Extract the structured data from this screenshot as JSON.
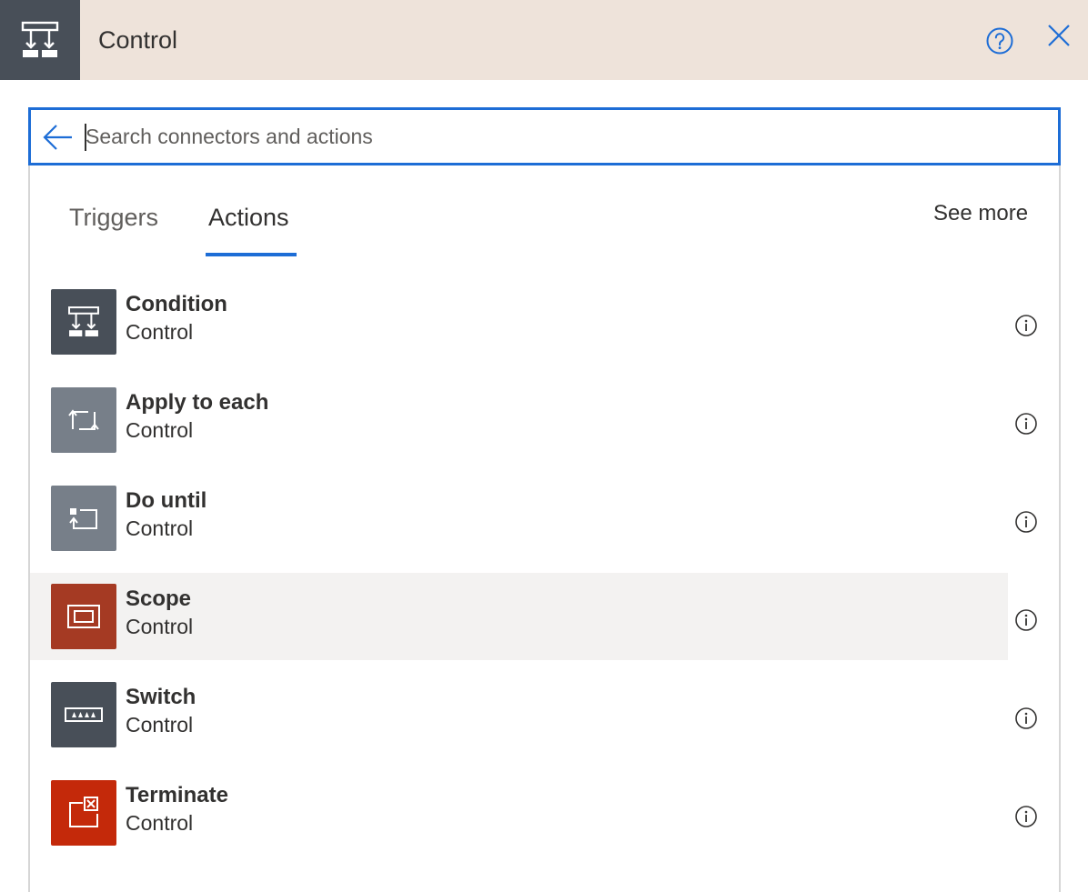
{
  "header": {
    "title": "Control",
    "icon": "condition-icon",
    "background": "#eee3da",
    "icon_bg": "#484f58",
    "help_icon": "help-icon",
    "close_icon": "close-icon"
  },
  "search": {
    "placeholder": "Search connectors and actions",
    "value": "",
    "back_icon": "back-arrow-icon",
    "border_color": "#1d6dd6"
  },
  "tabs": [
    {
      "label": "Triggers",
      "selected": false
    },
    {
      "label": "Actions",
      "selected": true
    }
  ],
  "see_more": "See more",
  "actions": [
    {
      "title": "Condition",
      "connector": "Control",
      "icon": "condition-icon",
      "color": "#484f58"
    },
    {
      "title": "Apply to each",
      "connector": "Control",
      "icon": "loop-icon",
      "color": "#777f89"
    },
    {
      "title": "Do until",
      "connector": "Control",
      "icon": "do-until-icon",
      "color": "#777f89"
    },
    {
      "title": "Scope",
      "connector": "Control",
      "icon": "scope-icon",
      "color": "#a53a23"
    },
    {
      "title": "Switch",
      "connector": "Control",
      "icon": "switch-icon",
      "color": "#484f58"
    },
    {
      "title": "Terminate",
      "connector": "Control",
      "icon": "terminate-icon",
      "color": "#c4290a"
    }
  ]
}
